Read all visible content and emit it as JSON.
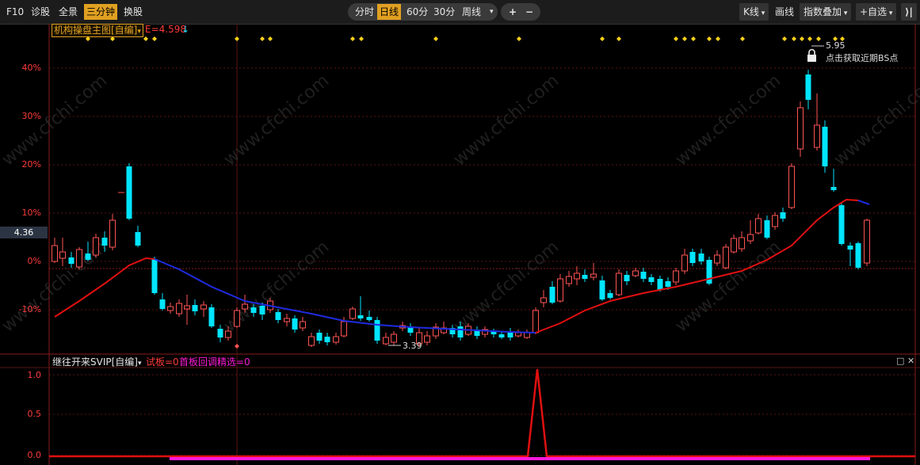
{
  "toolbar": {
    "f10": "F10",
    "diagnose": "诊股",
    "panorama": "全景",
    "three_min": "三分钟",
    "switch_stock": "换股",
    "periods": [
      "分时",
      "日线",
      "60分",
      "30分",
      "周线"
    ],
    "active_period": "日线",
    "plus": "+",
    "minus": "−",
    "kline": "K线",
    "draw": "画线",
    "index_overlay": "指数叠加",
    "watchlist": "+自选",
    "collapse": "⟩|"
  },
  "main_panel": {
    "indicator_name": "机构操盘主图[自编]",
    "indicator_value": "E=4.598",
    "indicator_arrow": "↓",
    "price_tag": "4.36",
    "y_ticks": [
      "40%",
      "30%",
      "20%",
      "10%",
      "0%",
      "-10%"
    ],
    "high_label": "5.95",
    "low_label": "3.39",
    "bs_hint": "点击获取近期BS点",
    "watermark": "www.cfchi.com"
  },
  "sub_panel": {
    "indicator_name": "继往开来SVIP[自编]",
    "values_red": "试板=0",
    "values_magenta": "首板回调精选=0",
    "y_ticks": [
      "1.0",
      "0.5",
      "0.0"
    ]
  },
  "colors": {
    "up": "#ff5454",
    "down": "#00e5ff",
    "ma_red": "#e01010",
    "ma_blue": "#1f2be0",
    "accent": "#e0a021",
    "diamond": "#ffd21a",
    "magenta": "#ff1ad9"
  }
}
